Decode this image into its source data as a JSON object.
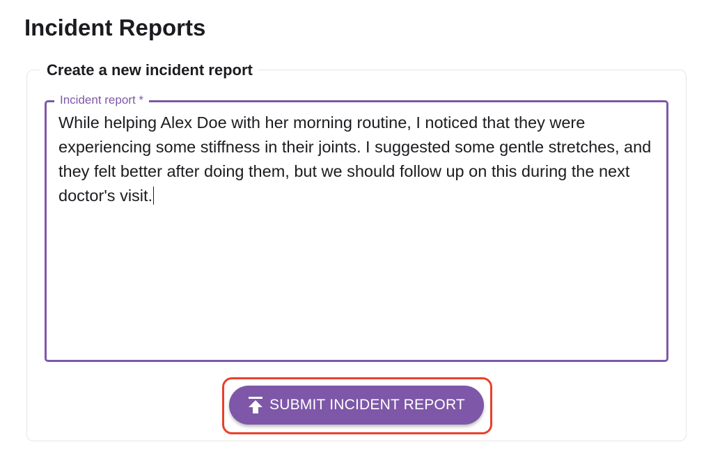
{
  "page": {
    "title": "Incident Reports"
  },
  "form": {
    "legend": "Create a new incident report",
    "field_label": "Incident report *",
    "field_value": "While helping Alex Doe with her morning routine, I noticed that they were experiencing some stiffness in their joints. I suggested some gentle stretches, and they felt better after doing them, but we should follow up on this during the next doctor's visit.",
    "submit_label": "SUBMIT INCIDENT REPORT",
    "submit_icon": "upload-icon"
  },
  "colors": {
    "accent": "#7e57a8",
    "highlight": "#e8402a",
    "text": "#1c1b1f"
  }
}
